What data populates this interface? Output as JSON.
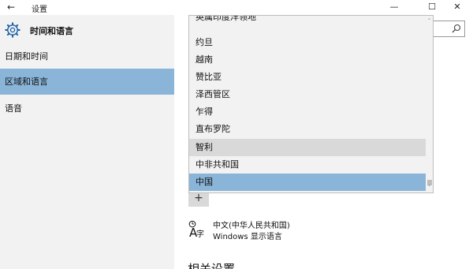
{
  "window": {
    "title": "设置",
    "back_glyph": "←",
    "minimize_glyph": "—",
    "maximize_glyph": "☐",
    "close_glyph": "✕"
  },
  "nav": {
    "header": "时间和语言",
    "items": [
      {
        "label": "日期和时间",
        "selected": false
      },
      {
        "label": "区域和语言",
        "selected": true
      },
      {
        "label": "语音",
        "selected": false
      }
    ]
  },
  "search": {
    "placeholder": ""
  },
  "dropdown": {
    "items": [
      {
        "label": "英属印度洋领地",
        "state": "normal"
      },
      {
        "label": "约旦",
        "state": "normal"
      },
      {
        "label": "越南",
        "state": "normal"
      },
      {
        "label": "赞比亚",
        "state": "normal"
      },
      {
        "label": "泽西管区",
        "state": "normal"
      },
      {
        "label": "乍得",
        "state": "normal"
      },
      {
        "label": "直布罗陀",
        "state": "normal"
      },
      {
        "label": "智利",
        "state": "hover"
      },
      {
        "label": "中非共和国",
        "state": "normal"
      },
      {
        "label": "中国",
        "state": "selected"
      }
    ],
    "scroll_up_glyph": "˄",
    "scroll_down_glyph": "˅"
  },
  "content": {
    "add_glyph": "+",
    "language": {
      "name": "中文(中华人民共和国)",
      "description": "Windows 显示语言"
    },
    "related_heading": "相关设置"
  },
  "colors": {
    "nav_background": "#f2f2f2",
    "selected_background": "#8ab4d8",
    "hover_background": "#d9d9d9"
  }
}
